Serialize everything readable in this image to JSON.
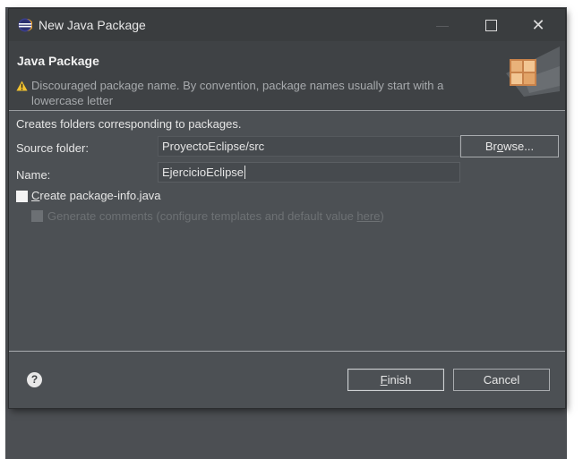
{
  "window": {
    "title": "New Java Package",
    "controls": {
      "minimize": "—",
      "maximize": "□",
      "close": "✕"
    }
  },
  "header": {
    "title": "Java Package",
    "message": "Discouraged package name. By convention, package names usually start with a lowercase letter"
  },
  "form": {
    "description": "Creates folders corresponding to packages.",
    "source_folder_label": "Source folder:",
    "source_folder_value": "ProyectoEclipse/src",
    "browse_prefix": "Br",
    "browse_mnemonic": "o",
    "browse_suffix": "wse...",
    "name_label": "Name:",
    "name_value": "EjercicioEclipse",
    "create_info_mnemonic": "C",
    "create_info_rest": "reate package-info.java",
    "generate_comments_text": "Generate comments (configure templates and default value ",
    "generate_comments_link": "here",
    "generate_comments_end": ")"
  },
  "footer": {
    "finish_mnemonic": "F",
    "finish_rest": "inish",
    "cancel_label": "Cancel"
  },
  "colors": {
    "background": "#4c5054",
    "titlebar": "#3a3d3f",
    "header": "#3f4245",
    "warning": "#f2c230"
  }
}
